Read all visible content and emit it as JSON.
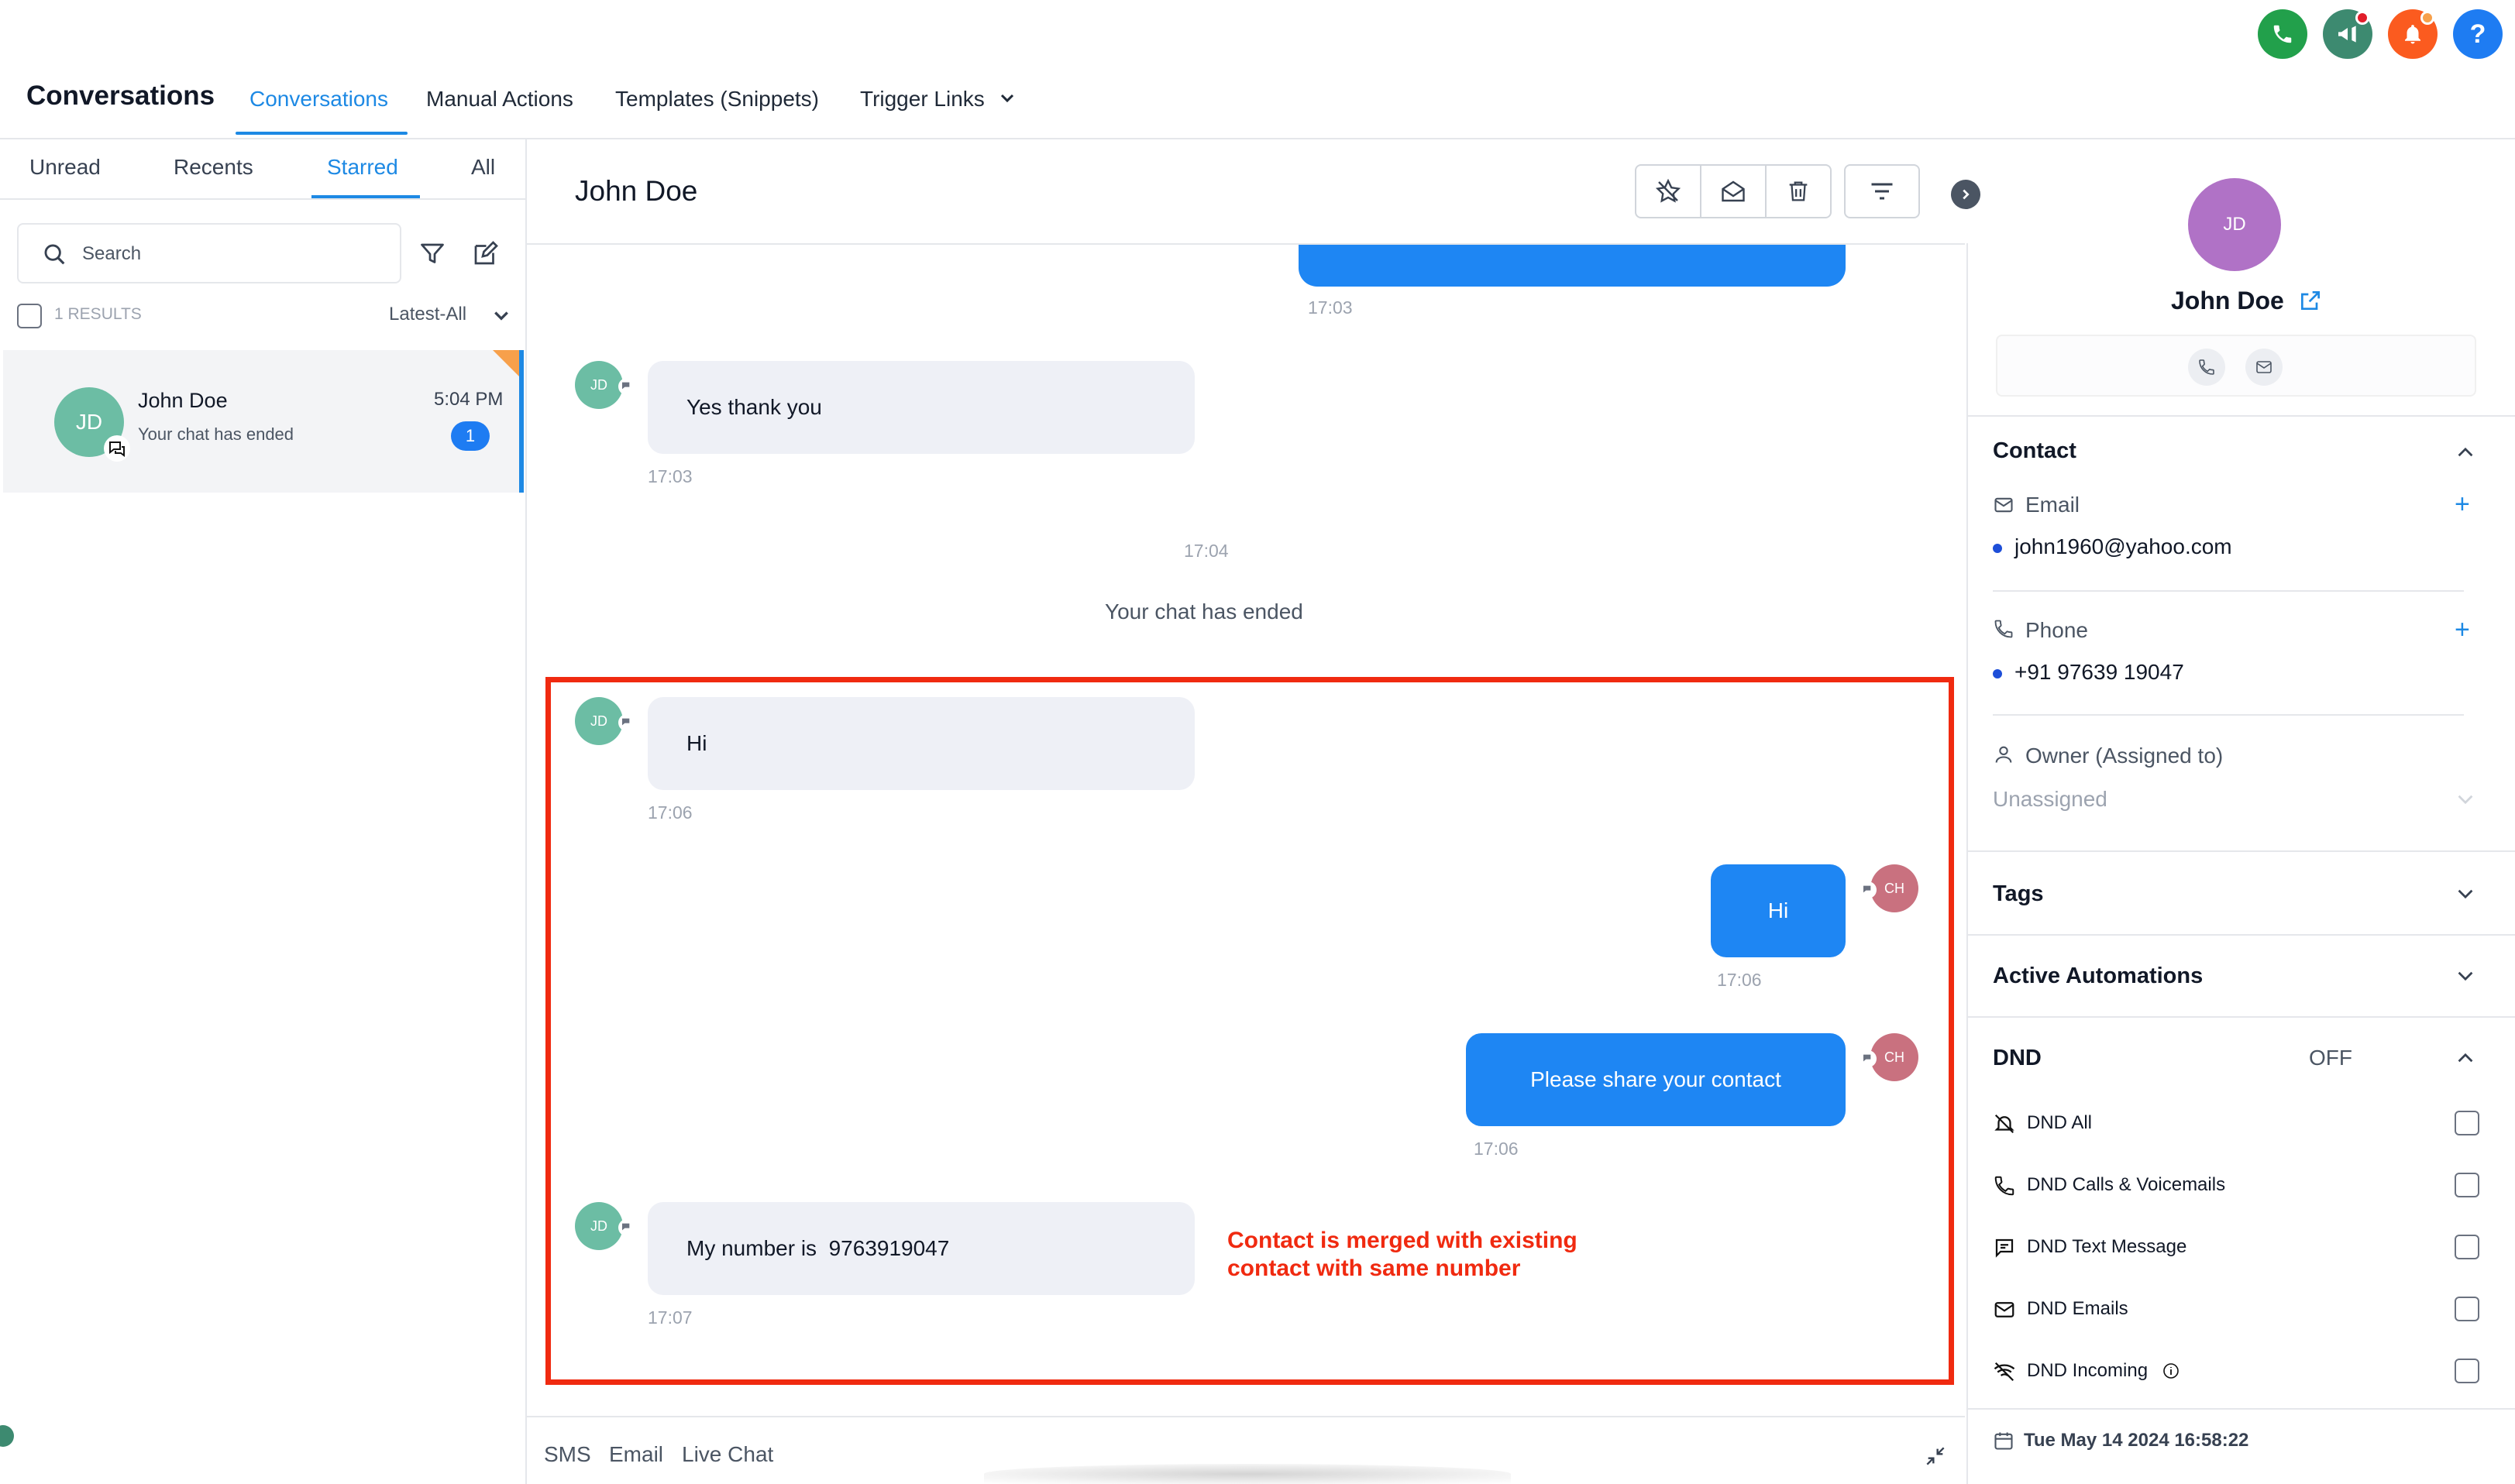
{
  "header": {
    "app_title": "Conversations",
    "nav_tabs": [
      {
        "label": "Conversations",
        "active": true
      },
      {
        "label": "Manual Actions",
        "active": false
      },
      {
        "label": "Templates (Snippets)",
        "active": false
      },
      {
        "label": "Trigger Links",
        "active": false
      }
    ],
    "top_icons": [
      {
        "name": "phone-icon",
        "color": "#22a04b"
      },
      {
        "name": "megaphone-icon",
        "color": "#3d8a70"
      },
      {
        "name": "bell-icon",
        "color": "#fb5b1f"
      },
      {
        "name": "help-icon",
        "color": "#1e7cf2"
      }
    ]
  },
  "left": {
    "tabs": [
      {
        "label": "Unread",
        "active": false
      },
      {
        "label": "Recents",
        "active": false
      },
      {
        "label": "Starred",
        "active": true
      },
      {
        "label": "All",
        "active": false
      }
    ],
    "search_placeholder": "Search",
    "results_count": "1 RESULTS",
    "sort_label": "Latest-All",
    "conversations": [
      {
        "initials": "JD",
        "name": "John Doe",
        "time": "5:04 PM",
        "preview": "Your chat has ended",
        "unread": "1"
      }
    ]
  },
  "center": {
    "contact_name": "John Doe",
    "messages": [
      {
        "time": "17:03"
      },
      {
        "initials": "JD",
        "text": "Yes thank you",
        "time": "17:03"
      },
      {
        "system_time": "17:04",
        "system_text": "Your chat has ended"
      },
      {
        "initials": "JD",
        "text": "Hi",
        "time": "17:06"
      },
      {
        "initials": "CH",
        "text": "Hi",
        "time": "17:06"
      },
      {
        "initials": "CH",
        "text": "Please share your contact",
        "time": "17:06"
      },
      {
        "initials": "JD",
        "text": "My number is  9763919047",
        "time": "17:07"
      }
    ],
    "annotation_line1": "Contact is merged with existing",
    "annotation_line2": "contact with same number",
    "bottom_tabs": [
      "SMS",
      "Email",
      "Live Chat"
    ]
  },
  "right": {
    "initials": "JD",
    "name": "John Doe",
    "contact_title": "Contact",
    "email_label": "Email",
    "email_value": "john1960@yahoo.com",
    "phone_label": "Phone",
    "phone_value": "+91 97639 19047",
    "owner_label": "Owner (Assigned to)",
    "owner_value": "Unassigned",
    "tags_title": "Tags",
    "automations_title": "Active Automations",
    "dnd_title": "DND",
    "dnd_status": "OFF",
    "dnd_items": [
      {
        "label": "DND All",
        "checked": false
      },
      {
        "label": "DND Calls & Voicemails",
        "checked": false
      },
      {
        "label": "DND Text Message",
        "checked": false
      },
      {
        "label": "DND Emails",
        "checked": false
      },
      {
        "label": "DND Incoming",
        "checked": false
      }
    ],
    "created_at": "Tue May 14 2024 16:58:22"
  },
  "colors": {
    "accent": "#1d89e4",
    "outgoing_bubble": "#1e86f3",
    "incoming_bubble": "#eef0f6",
    "highlight": "#f02a10",
    "avatar_jd": "#6cbda4",
    "avatar_ch": "#c9717f",
    "avatar_purple": "#b072c6"
  }
}
